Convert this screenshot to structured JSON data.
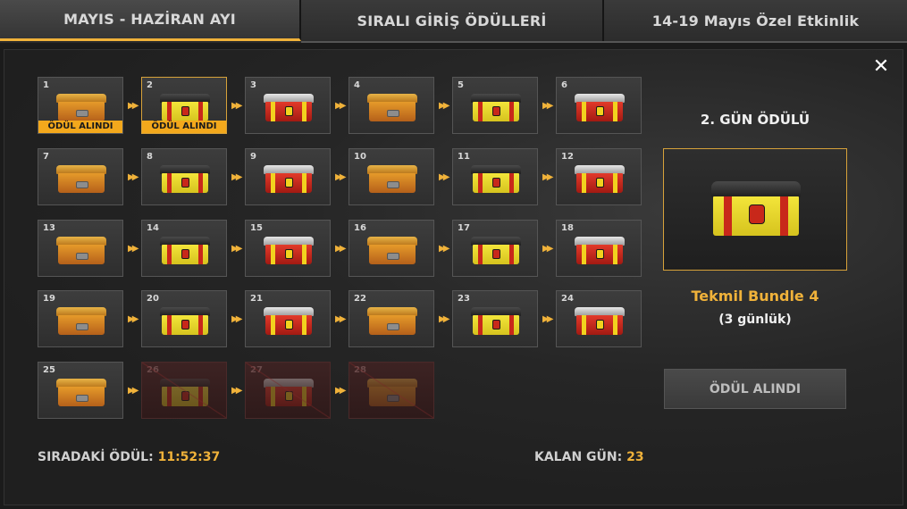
{
  "tabs": [
    {
      "label": "MAYIS - HAZİRAN AYI",
      "active": true
    },
    {
      "label": "SIRALI GİRİŞ ÖDÜLLERİ",
      "active": false
    },
    {
      "label": "14-19 Mayıs Özel Etkinlik",
      "active": false
    }
  ],
  "close_icon": "close-icon",
  "claimed_badge": "ÖDÜL ALINDI",
  "days": [
    {
      "day": "1",
      "chest": "orange",
      "claimed": true
    },
    {
      "day": "2",
      "chest": "yellow",
      "claimed": true,
      "selected": true
    },
    {
      "day": "3",
      "chest": "red"
    },
    {
      "day": "4",
      "chest": "orange"
    },
    {
      "day": "5",
      "chest": "yellow"
    },
    {
      "day": "6",
      "chest": "red"
    },
    {
      "day": "7",
      "chest": "orange"
    },
    {
      "day": "8",
      "chest": "yellow"
    },
    {
      "day": "9",
      "chest": "red"
    },
    {
      "day": "10",
      "chest": "orange"
    },
    {
      "day": "11",
      "chest": "yellow"
    },
    {
      "day": "12",
      "chest": "red"
    },
    {
      "day": "13",
      "chest": "orange"
    },
    {
      "day": "14",
      "chest": "yellow"
    },
    {
      "day": "15",
      "chest": "red"
    },
    {
      "day": "16",
      "chest": "orange"
    },
    {
      "day": "17",
      "chest": "yellow"
    },
    {
      "day": "18",
      "chest": "red"
    },
    {
      "day": "19",
      "chest": "orange"
    },
    {
      "day": "20",
      "chest": "yellow"
    },
    {
      "day": "21",
      "chest": "red"
    },
    {
      "day": "22",
      "chest": "orange"
    },
    {
      "day": "23",
      "chest": "yellow"
    },
    {
      "day": "24",
      "chest": "red"
    },
    {
      "day": "25",
      "chest": "orange"
    },
    {
      "day": "26",
      "chest": "yellow",
      "locked": true
    },
    {
      "day": "27",
      "chest": "red",
      "locked": true
    },
    {
      "day": "28",
      "chest": "orange",
      "locked": true
    }
  ],
  "reward": {
    "title": "2. GÜN ÖDÜLÜ",
    "name": "Tekmil Bundle 4",
    "duration": "(3 günlük)",
    "button_label": "ÖDÜL ALINDI"
  },
  "footer": {
    "next_label": "SIRADAKİ ÖDÜL:",
    "next_value": "11:52:37",
    "days_left_label": "KALAN GÜN:",
    "days_left_value": "23"
  },
  "colors": {
    "accent": "#f0b23a",
    "badge": "#f3a81c"
  }
}
